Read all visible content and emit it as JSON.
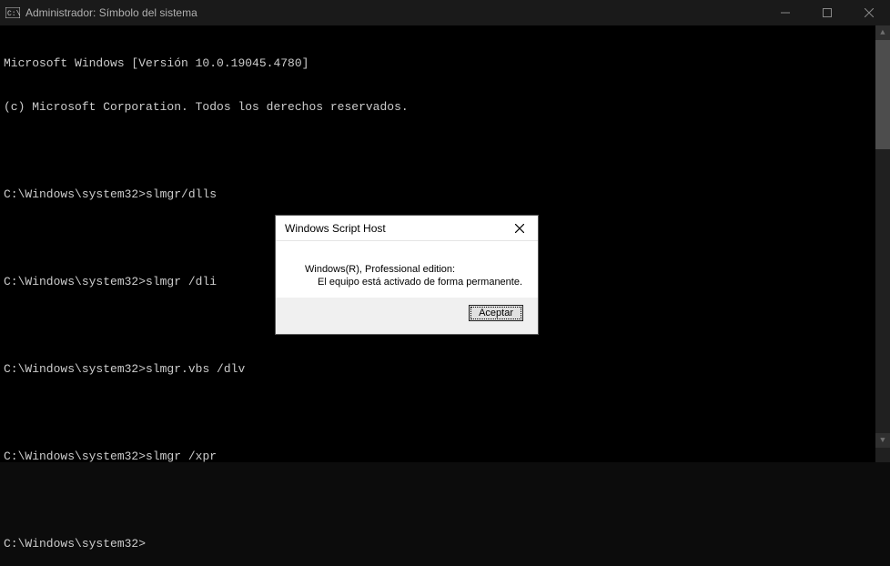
{
  "window": {
    "title": "Administrador: Símbolo del sistema"
  },
  "console": {
    "header1": "Microsoft Windows [Versión 10.0.19045.4780]",
    "header2": "(c) Microsoft Corporation. Todos los derechos reservados.",
    "prompt": "C:\\Windows\\system32>",
    "cmd1": "slmgr/dlls",
    "cmd2": "slmgr /dli",
    "cmd3": "slmgr.vbs /dlv",
    "cmd4": "slmgr /xpr"
  },
  "dialog": {
    "title": "Windows Script Host",
    "line1": "Windows(R), Professional edition:",
    "line2": "El equipo está activado de forma permanente.",
    "ok_label": "Aceptar"
  }
}
